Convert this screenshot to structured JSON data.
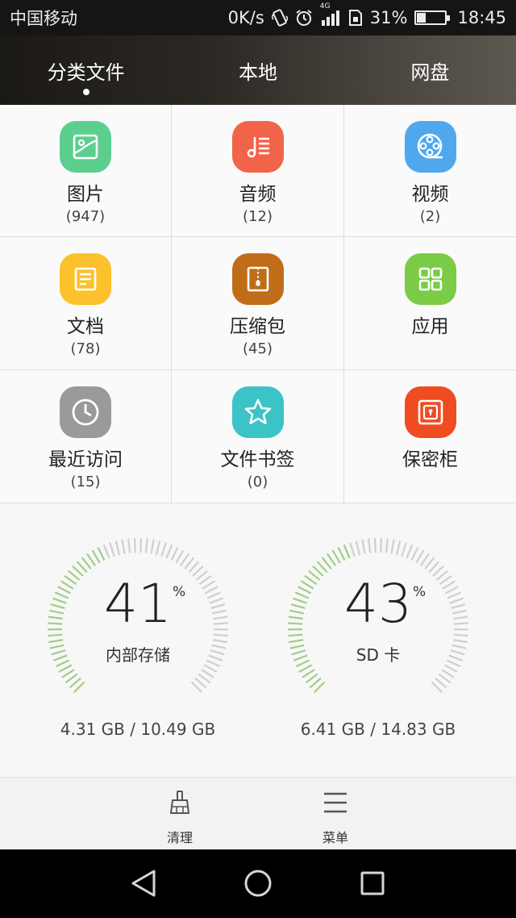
{
  "status_bar": {
    "carrier": "中国移动",
    "net_speed": "0K/s",
    "network_type": "4G",
    "battery_percent": "31%",
    "battery_level": 0.31,
    "time": "18:45",
    "icons": [
      "vibrate-icon",
      "alarm-icon",
      "signal-icon",
      "sim-icon",
      "battery-icon"
    ]
  },
  "tabs": [
    {
      "label": "分类文件",
      "active": true
    },
    {
      "label": "本地",
      "active": false
    },
    {
      "label": "网盘",
      "active": false
    }
  ],
  "categories": [
    {
      "label": "图片",
      "count": "(947)",
      "icon": "image-icon",
      "color": "#5ccf8e"
    },
    {
      "label": "音频",
      "count": "(12)",
      "icon": "music-icon",
      "color": "#f2644a"
    },
    {
      "label": "视频",
      "count": "(2)",
      "icon": "film-reel-icon",
      "color": "#4fa8ee"
    },
    {
      "label": "文档",
      "count": "(78)",
      "icon": "document-icon",
      "color": "#fcc12c"
    },
    {
      "label": "压缩包",
      "count": "(45)",
      "icon": "zip-archive-icon",
      "color": "#c06d1a"
    },
    {
      "label": "应用",
      "count": "",
      "icon": "apps-grid-icon",
      "color": "#7bcb47"
    },
    {
      "label": "最近访问",
      "count": "(15)",
      "icon": "clock-icon",
      "color": "#9a9a9a"
    },
    {
      "label": "文件书签",
      "count": "(0)",
      "icon": "star-icon",
      "color": "#3bc3c8"
    },
    {
      "label": "保密柜",
      "count": "",
      "icon": "safe-icon",
      "color": "#ef4c22"
    }
  ],
  "storage": [
    {
      "name": "内部存储",
      "percent": "41",
      "percent_sign": "%",
      "usage": "4.31 GB / 10.49 GB",
      "used_fraction": 0.41
    },
    {
      "name": "SD 卡",
      "percent": "43",
      "percent_sign": "%",
      "usage": "6.41 GB / 14.83 GB",
      "used_fraction": 0.43
    }
  ],
  "bottom_bar": {
    "clean_label": "清理",
    "menu_label": "菜单"
  },
  "colors": {
    "gauge_used": "#a3cc8a",
    "gauge_free": "#cfcfcf"
  }
}
